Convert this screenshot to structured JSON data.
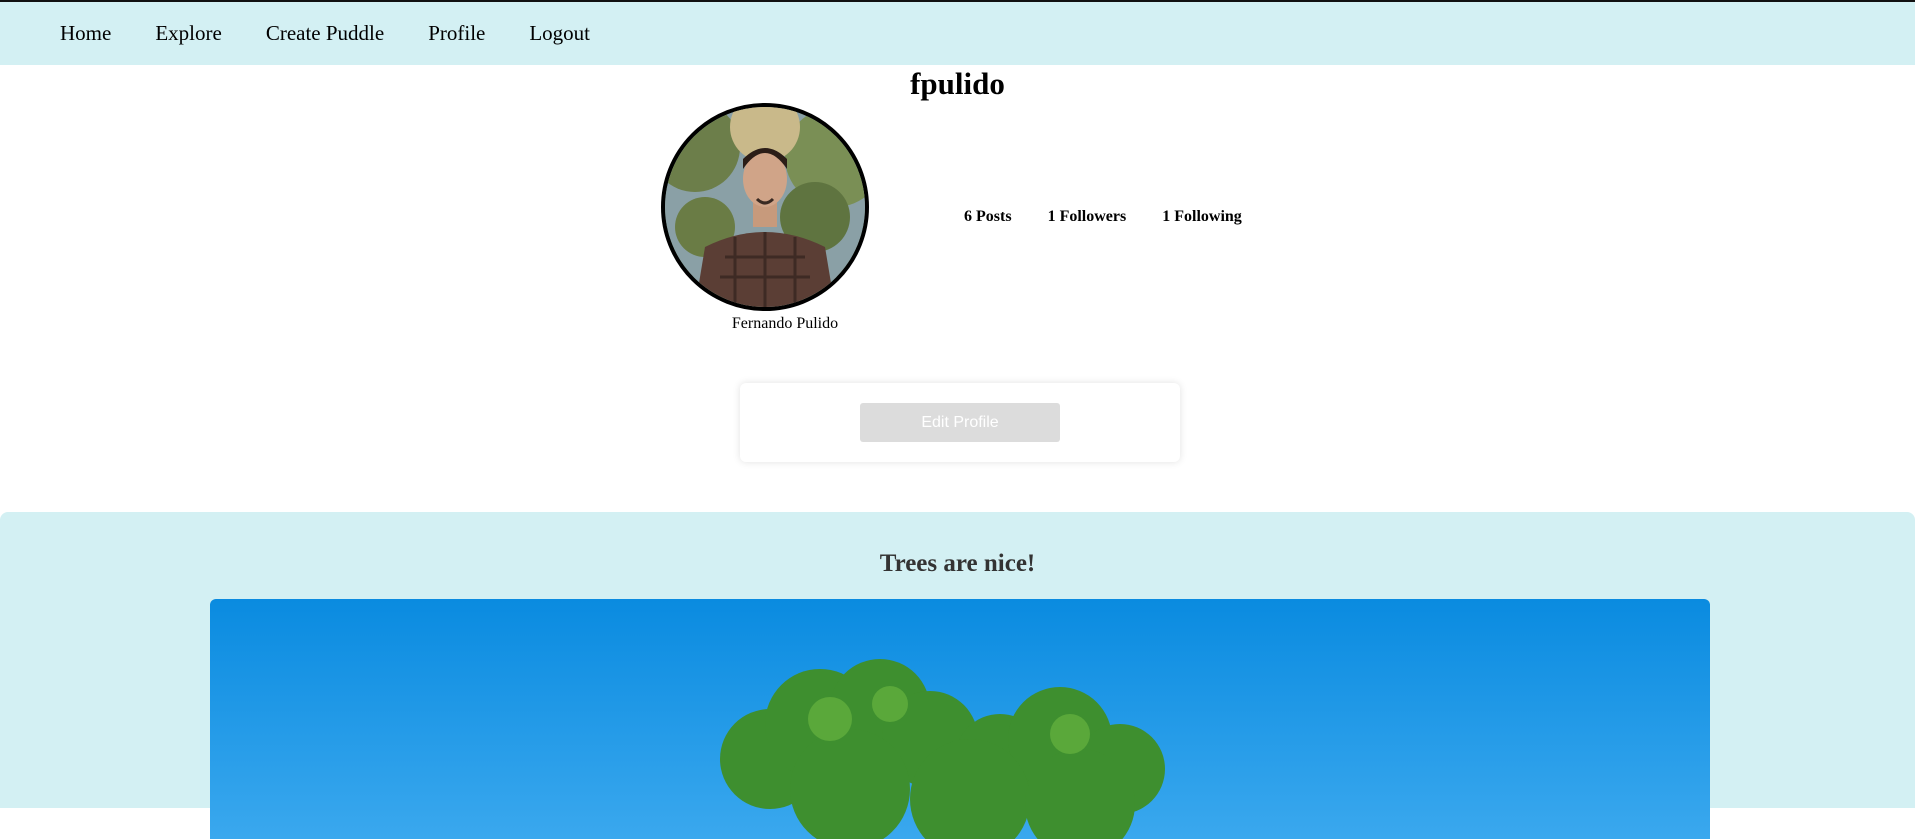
{
  "nav": {
    "items": [
      {
        "label": "Home"
      },
      {
        "label": "Explore"
      },
      {
        "label": "Create Puddle"
      },
      {
        "label": "Profile"
      },
      {
        "label": "Logout"
      }
    ]
  },
  "profile": {
    "username": "fpulido",
    "full_name": "Fernando Pulido",
    "posts_label": "6 Posts",
    "followers_label": "1 Followers",
    "following_label": "1 Following",
    "edit_button_label": "Edit Profile"
  },
  "feed": {
    "posts": [
      {
        "title": "Trees are nice!"
      }
    ]
  },
  "colors": {
    "nav_bg": "#d3f0f3",
    "feed_bg": "#d3f0f3",
    "edit_button_bg": "#dcdcdc",
    "sky_top": "#0a8be0"
  }
}
